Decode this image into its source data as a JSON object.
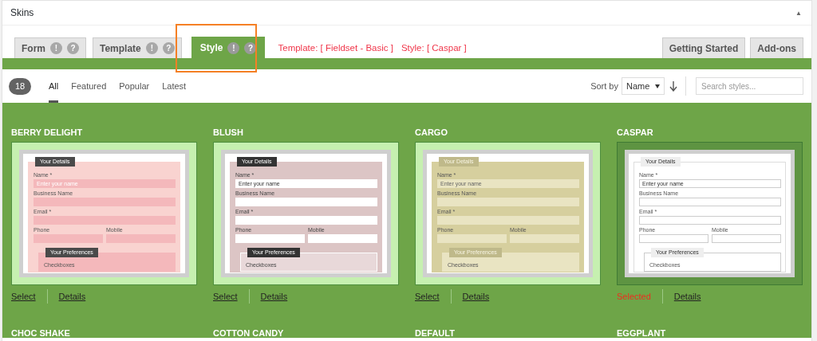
{
  "panel": {
    "title": "Skins",
    "collapse_toggle": "▲"
  },
  "tabs": [
    {
      "label": "Form",
      "info": "!",
      "help": "?",
      "selected": false
    },
    {
      "label": "Template",
      "info": "!",
      "help": "?",
      "selected": false
    },
    {
      "label": "Style",
      "info": "!",
      "help": "?",
      "selected": true
    }
  ],
  "current_choice": [
    "Template: [ Fieldset - Basic ]",
    "Style: [ Caspar ]"
  ],
  "side_tabs": [
    "Getting Started",
    "Add-ons"
  ],
  "count": "18",
  "filters": [
    {
      "label": "All",
      "selected": true
    },
    {
      "label": "Featured",
      "selected": false
    },
    {
      "label": "Popular",
      "selected": false
    },
    {
      "label": "Latest",
      "selected": false
    }
  ],
  "sort": {
    "label": "Sort by",
    "value": "Name"
  },
  "search": {
    "placeholder": "Search styles..."
  },
  "skins": [
    {
      "name": "BERRY DELIGHT",
      "kind": "berry",
      "selected": false,
      "action": "Select",
      "details": "Details",
      "preview": {
        "section_1": "Your Details",
        "name_label": "Name *",
        "name_placeholder": "Enter your name",
        "business_label": "Business Name",
        "email_label": "Email *",
        "phone_label": "Phone",
        "mobile_label": "Mobile",
        "section_2": "Your Preferences",
        "checkboxes_label": "Checkboxes"
      }
    },
    {
      "name": "BLUSH",
      "kind": "blush",
      "selected": false,
      "action": "Select",
      "details": "Details",
      "preview": {
        "section_1": "Your Details",
        "name_label": "Name *",
        "name_placeholder": "Enter your name",
        "business_label": "Business Name",
        "email_label": "Email *",
        "phone_label": "Phone",
        "mobile_label": "Mobile",
        "section_2": "Your Preferences",
        "checkboxes_label": "Checkboxes"
      }
    },
    {
      "name": "CARGO",
      "kind": "cargo",
      "selected": false,
      "action": "Select",
      "details": "Details",
      "preview": {
        "section_1": "Your Details",
        "name_label": "Name *",
        "name_placeholder": "Enter your name",
        "business_label": "Business Name",
        "email_label": "Email *",
        "phone_label": "Phone",
        "mobile_label": "Mobile",
        "section_2": "Your Preferences",
        "checkboxes_label": "Checkboxes"
      }
    },
    {
      "name": "CASPAR",
      "kind": "caspar",
      "selected": true,
      "action": "Selected",
      "details": "Details",
      "preview": {
        "section_1": "Your Details",
        "name_label": "Name *",
        "name_placeholder": "Enter your name",
        "business_label": "Business Name",
        "email_label": "Email *",
        "phone_label": "Phone",
        "mobile_label": "Mobile",
        "section_2": "Your Preferences",
        "checkboxes_label": "Checkboxes"
      }
    }
  ],
  "more_skins": [
    "CHOC SHAKE",
    "COTTON CANDY",
    "DEFAULT",
    "EGGPLANT"
  ]
}
